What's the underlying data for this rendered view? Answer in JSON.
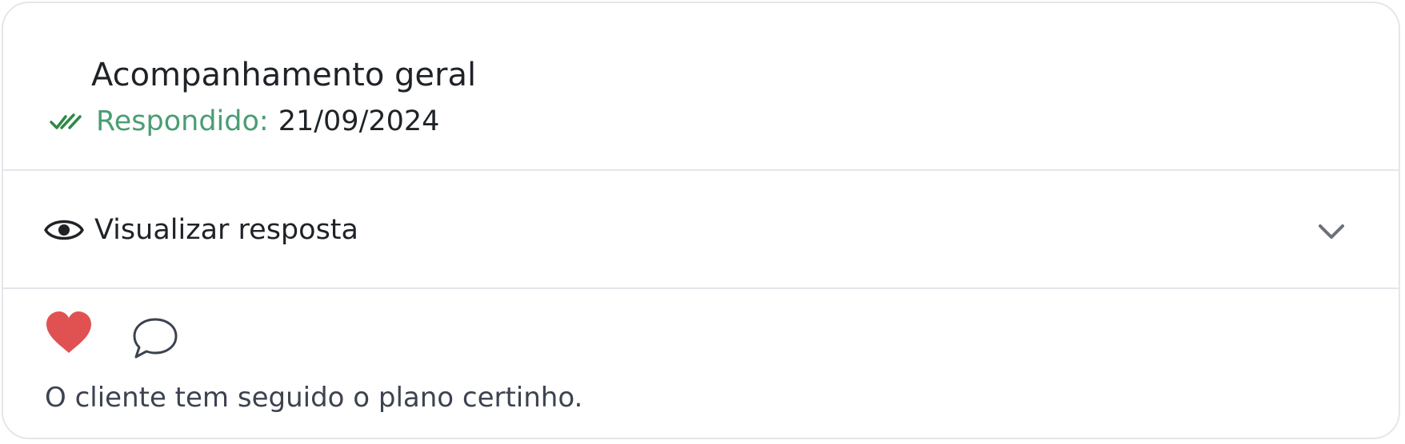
{
  "card": {
    "title": "Acompanhamento geral",
    "status": {
      "label": "Respondido:",
      "date": "21/09/2024",
      "icon": "double-check-icon",
      "color": "#4a9d73"
    },
    "toggle": {
      "label": "Visualizar resposta",
      "icon": "eye-icon",
      "chevron": "chevron-down-icon"
    },
    "reactions": {
      "like_icon": "heart-icon",
      "like_color": "#e05252",
      "comment_icon": "comment-icon",
      "liked": true
    },
    "comment": "O cliente tem seguido o plano certinho."
  }
}
